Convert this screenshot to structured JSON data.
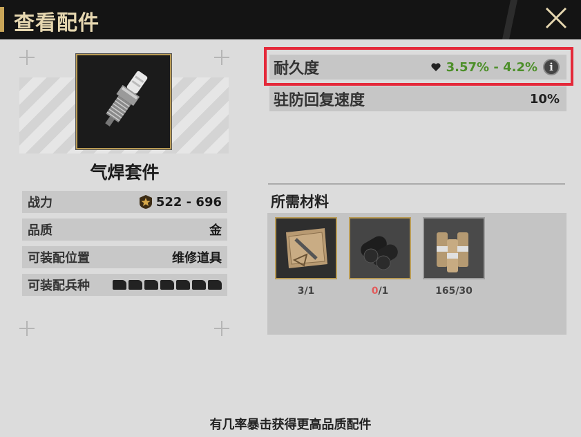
{
  "header": {
    "title": "查看配件"
  },
  "item": {
    "name": "气焊套件",
    "icon": "spark-plug-icon"
  },
  "stats": [
    {
      "label": "战力",
      "value": "522 - 696"
    },
    {
      "label": "品质",
      "value": "金"
    },
    {
      "label": "可装配位置",
      "value": "维修道具"
    },
    {
      "label": "可装配兵种",
      "value": ""
    }
  ],
  "attributes": {
    "durability": {
      "label": "耐久度",
      "value": "3.57% - 4.2%",
      "info": "i"
    },
    "garrison": {
      "label": "驻防回复速度",
      "value": "10%"
    }
  },
  "materials": {
    "title": "所需材料",
    "items": [
      {
        "icon": "blueprint-icon",
        "have": "3",
        "need": "/1",
        "sufficient": true
      },
      {
        "icon": "steel-rolls-icon",
        "have": "0",
        "need": "/1",
        "sufficient": false
      },
      {
        "icon": "canisters-icon",
        "have": "165",
        "need": "/30",
        "sufficient": true
      }
    ]
  },
  "footer": {
    "text": "有几率暴击获得更高品质配件"
  },
  "colors": {
    "gold": "#c9a659",
    "highlight": "#e4293a",
    "green": "#4d8f2a",
    "red": "#e25a5a"
  }
}
